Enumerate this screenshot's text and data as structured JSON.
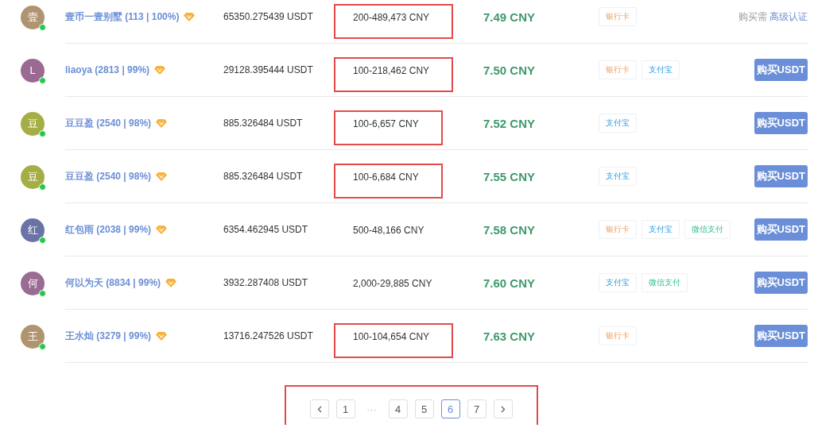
{
  "offers": [
    {
      "avatar": {
        "initial": "壹",
        "color": "#b09470"
      },
      "online": true,
      "name": "壹币一壹别墅 (113 | 100%)",
      "verified": true,
      "amount": "65350.275439 USDT",
      "limit": "200-489,473 CNY",
      "limit_highlighted": true,
      "price": "7.49 CNY",
      "payments": [
        {
          "kind": "bank",
          "label": "银行卡"
        }
      ],
      "action": {
        "kind": "notice",
        "text": "购买需",
        "link": "高级认证"
      }
    },
    {
      "avatar": {
        "initial": "L",
        "color": "#9a6a93"
      },
      "online": true,
      "name": "liaoya (2813 | 99%)",
      "verified": true,
      "amount": "29128.395444 USDT",
      "limit": "100-218,462 CNY",
      "limit_highlighted": true,
      "price": "7.50 CNY",
      "payments": [
        {
          "kind": "bank",
          "label": "银行卡"
        },
        {
          "kind": "alipay",
          "label": "支付宝"
        }
      ],
      "action": {
        "kind": "button",
        "label": "购买USDT"
      }
    },
    {
      "avatar": {
        "initial": "豆",
        "color": "#a5ae45"
      },
      "online": true,
      "name": "豆豆盈 (2540 | 98%)",
      "verified": true,
      "amount": "885.326484 USDT",
      "limit": "100-6,657 CNY",
      "limit_highlighted": true,
      "price": "7.52 CNY",
      "payments": [
        {
          "kind": "alipay",
          "label": "支付宝"
        }
      ],
      "action": {
        "kind": "button",
        "label": "购买USDT"
      }
    },
    {
      "avatar": {
        "initial": "豆",
        "color": "#a5ae45"
      },
      "online": true,
      "name": "豆豆盈 (2540 | 98%)",
      "verified": true,
      "amount": "885.326484 USDT",
      "limit": "100-6,684 CNY",
      "limit_highlighted": true,
      "price": "7.55 CNY",
      "payments": [
        {
          "kind": "alipay",
          "label": "支付宝"
        }
      ],
      "action": {
        "kind": "button",
        "label": "购买USDT"
      }
    },
    {
      "avatar": {
        "initial": "红",
        "color": "#6a73a6"
      },
      "online": true,
      "name": "红包雨 (2038 | 99%)",
      "verified": true,
      "amount": "6354.462945 USDT",
      "limit": "500-48,166 CNY",
      "limit_highlighted": false,
      "price": "7.58 CNY",
      "payments": [
        {
          "kind": "bank",
          "label": "银行卡"
        },
        {
          "kind": "alipay",
          "label": "支付宝"
        },
        {
          "kind": "wechat",
          "label": "微信支付"
        }
      ],
      "action": {
        "kind": "button",
        "label": "购买USDT"
      }
    },
    {
      "avatar": {
        "initial": "何",
        "color": "#9a6b93"
      },
      "online": true,
      "name": "何以为天 (8834 | 99%)",
      "verified": true,
      "amount": "3932.287408 USDT",
      "limit": "2,000-29,885 CNY",
      "limit_highlighted": false,
      "price": "7.60 CNY",
      "payments": [
        {
          "kind": "alipay",
          "label": "支付宝"
        },
        {
          "kind": "wechat",
          "label": "微信支付"
        }
      ],
      "action": {
        "kind": "button",
        "label": "购买USDT"
      }
    },
    {
      "avatar": {
        "initial": "王",
        "color": "#b09470"
      },
      "online": true,
      "name": "王水灿 (3279 | 99%)",
      "verified": true,
      "amount": "13716.247526 USDT",
      "limit": "100-104,654 CNY",
      "limit_highlighted": true,
      "price": "7.63 CNY",
      "payments": [
        {
          "kind": "bank",
          "label": "银行卡"
        }
      ],
      "action": {
        "kind": "button",
        "label": "购买USDT"
      }
    }
  ],
  "pagination": {
    "highlighted": true,
    "items": [
      {
        "kind": "prev"
      },
      {
        "kind": "page",
        "label": "1",
        "selected": false
      },
      {
        "kind": "ellipsis",
        "label": "···"
      },
      {
        "kind": "page",
        "label": "4",
        "selected": false
      },
      {
        "kind": "page",
        "label": "5",
        "selected": false
      },
      {
        "kind": "page",
        "label": "6",
        "selected": true
      },
      {
        "kind": "page",
        "label": "7",
        "selected": false
      },
      {
        "kind": "next"
      }
    ]
  }
}
